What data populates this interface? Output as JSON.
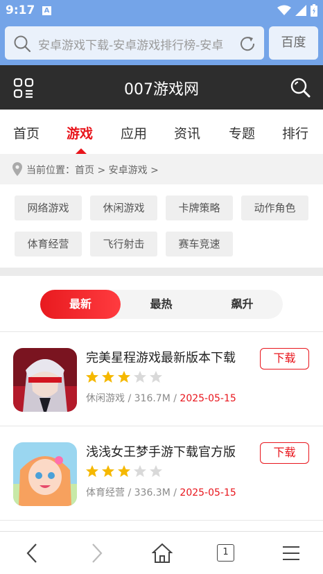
{
  "statusbar": {
    "time": "9:17",
    "a_icon": "A"
  },
  "browser": {
    "url_text": "安卓游戏下载-安卓游戏排行榜-安卓",
    "search_engine_button": "百度"
  },
  "site": {
    "title": "007游戏网"
  },
  "nav": {
    "items": [
      {
        "label": "首页"
      },
      {
        "label": "游戏"
      },
      {
        "label": "应用"
      },
      {
        "label": "资讯"
      },
      {
        "label": "专题"
      },
      {
        "label": "排行"
      }
    ],
    "active_index": 1
  },
  "breadcrumb": {
    "text": "当前位置：首页 > 安卓游戏 >"
  },
  "categories": [
    "网络游戏",
    "休闲游戏",
    "卡牌策略",
    "动作角色",
    "体育经营",
    "飞行射击",
    "赛车竞速"
  ],
  "sort_tabs": {
    "options": [
      "最新",
      "最热",
      "飙升"
    ],
    "active_index": 0
  },
  "games": [
    {
      "name": "完美星程游戏最新版本下载",
      "rating": 3,
      "max_rating": 5,
      "category": "休闲游戏",
      "size": "316.7M",
      "date": "2025-05-15",
      "button": "下载"
    },
    {
      "name": "浅浅女王梦手游下载官方版",
      "rating": 3,
      "max_rating": 5,
      "category": "体育经营",
      "size": "336.3M",
      "date": "2025-05-15",
      "button": "下载"
    }
  ],
  "meta_separator": " / ",
  "bottombar": {
    "tab_count": "1"
  },
  "colors": {
    "accent": "#e8141b",
    "browser_blue": "#74a4e8",
    "header_dark": "#2d2d2d",
    "star_on": "#f5b800",
    "star_off": "#d9d9d9"
  },
  "icons": [
    "search-icon",
    "reload-icon",
    "menu-grid-icon",
    "site-search-icon",
    "location-pin-icon",
    "star-icon",
    "back-icon",
    "forward-icon",
    "home-icon",
    "tabs-icon",
    "browser-menu-icon",
    "wifi-icon",
    "signal-icon",
    "battery-icon"
  ]
}
